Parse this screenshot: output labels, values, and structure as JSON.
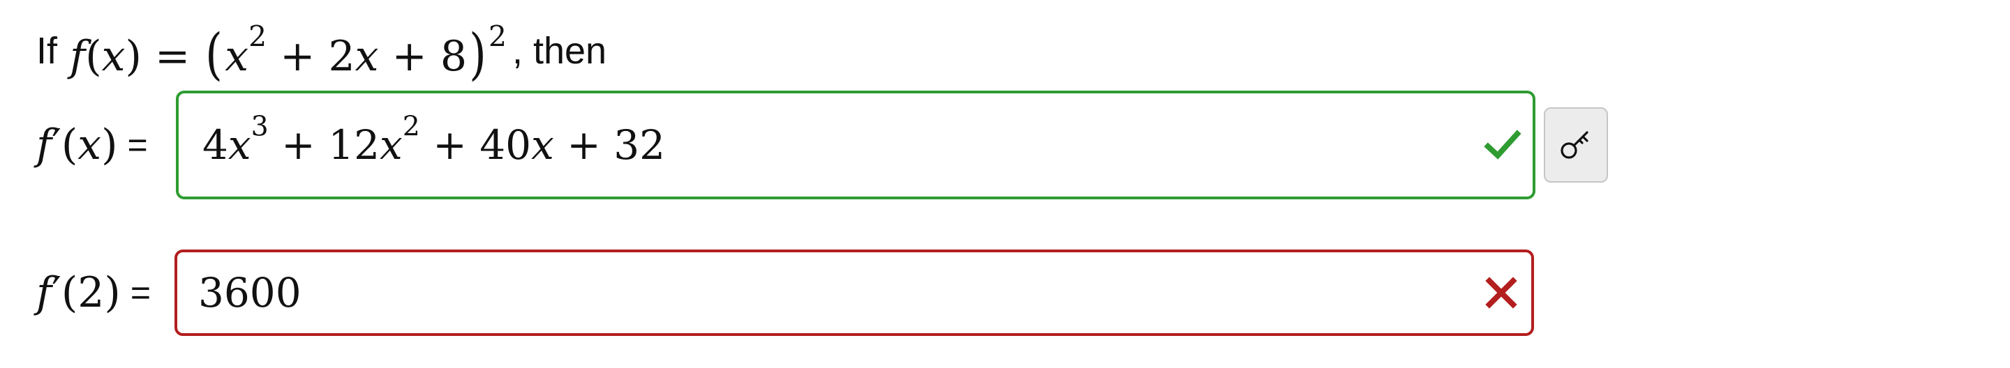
{
  "question": {
    "intro_word": "If",
    "function_math": "f(x) = (x² + 2x + 8)²",
    "then_word": ", then"
  },
  "derivative_row": {
    "label": "f′(x)",
    "equals": "=",
    "answer_value": "4x³ + 12x² + 40x + 32",
    "status": "correct",
    "status_icon": "checkmark-icon",
    "status_color": "#2f9c32",
    "has_answer_key_button": true,
    "answer_key_icon": "key-icon"
  },
  "evaluation_row": {
    "label": "f′(2)",
    "equals": "=",
    "answer_value": "3600",
    "status": "incorrect",
    "status_icon": "cross-icon",
    "status_color": "#b31e1e"
  },
  "colors": {
    "correct": "#2f9c32",
    "incorrect": "#b31e1e",
    "key_button_bg": "#ececec"
  }
}
